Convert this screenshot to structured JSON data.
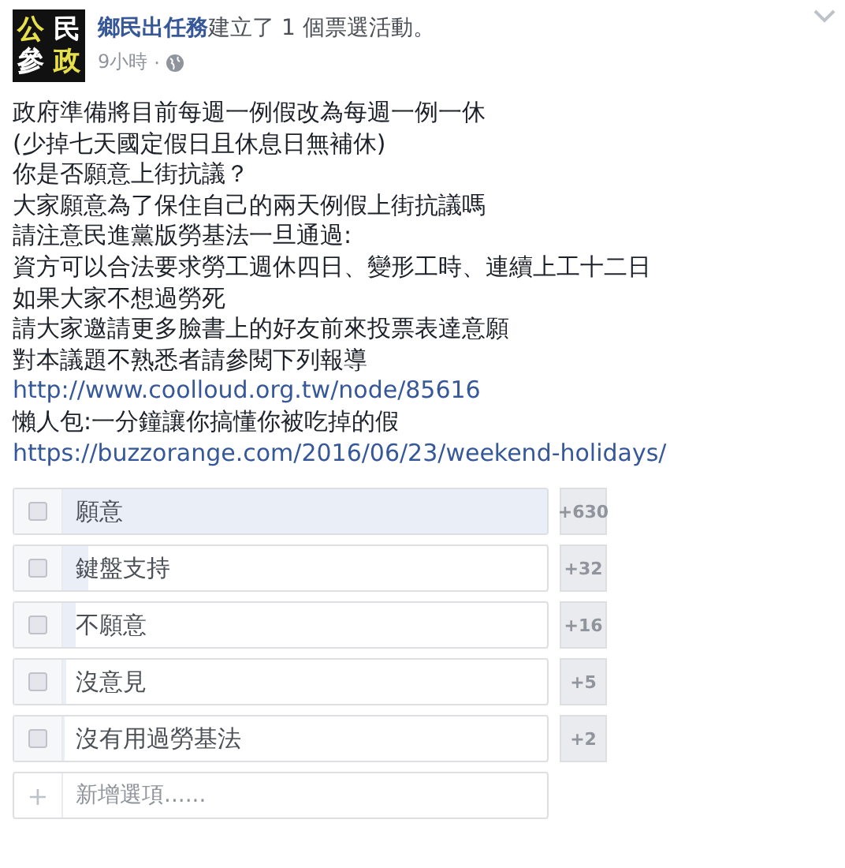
{
  "post": {
    "logo": [
      {
        "char": "公",
        "color": "#e8e04a"
      },
      {
        "char": "民",
        "color": "#ffffff"
      },
      {
        "char": "參",
        "color": "#ffffff"
      },
      {
        "char": "政",
        "color": "#e8e04a"
      }
    ],
    "author": "鄉民出任務",
    "action": "建立了 1 個票選活動。",
    "time": "9小時",
    "separator": "·",
    "lines": [
      {
        "kind": "text",
        "text": "政府準備將目前每週一例假改為每週一例一休"
      },
      {
        "kind": "text",
        "text": "(少掉七天國定假日且休息日無補休)"
      },
      {
        "kind": "text",
        "text": "你是否願意上街抗議？"
      },
      {
        "kind": "text",
        "text": "大家願意為了保住自己的兩天例假上街抗議嗎"
      },
      {
        "kind": "text",
        "text": "請注意民進黨版勞基法一旦通過:"
      },
      {
        "kind": "text",
        "text": "資方可以合法要求勞工週休四日、變形工時、連續上工十二日"
      },
      {
        "kind": "text",
        "text": "如果大家不想過勞死"
      },
      {
        "kind": "text",
        "text": "請大家邀請更多臉書上的好友前來投票表達意願"
      },
      {
        "kind": "text",
        "text": "對本議題不熟悉者請參閱下列報導"
      },
      {
        "kind": "link",
        "text": "http://www.coolloud.org.tw/node/85616"
      },
      {
        "kind": "text",
        "text": "懶人包:一分鐘讓你搞懂你被吃掉的假"
      },
      {
        "kind": "link",
        "text": "https://buzzorange.com/2016/06/23/weekend-holidays/"
      }
    ]
  },
  "poll": {
    "options": [
      {
        "label": "願意",
        "checked": false,
        "count": "+630"
      },
      {
        "label": "鍵盤支持",
        "checked": false,
        "count": "+32"
      },
      {
        "label": "不願意",
        "checked": false,
        "count": "+16"
      },
      {
        "label": "沒意見",
        "checked": false,
        "count": "+5"
      },
      {
        "label": "沒有用過勞基法",
        "checked": false,
        "count": "+2"
      }
    ],
    "add_option": {
      "icon": "+",
      "placeholder": "新增選項......"
    }
  }
}
